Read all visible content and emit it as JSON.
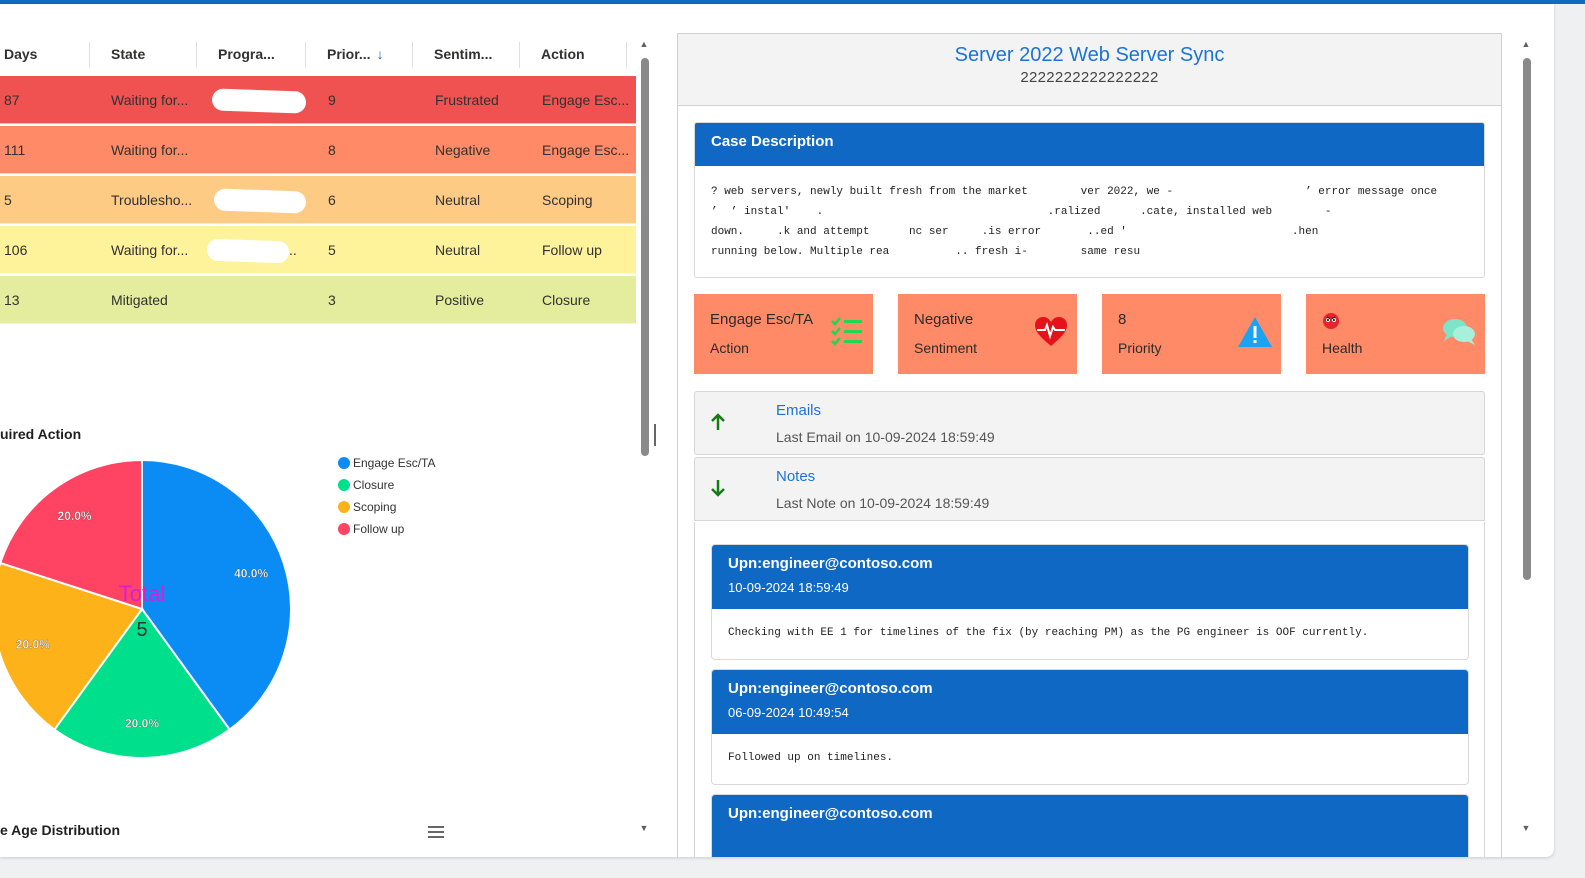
{
  "grid": {
    "headers": [
      {
        "label": "Days"
      },
      {
        "label": "State"
      },
      {
        "label": "Progra..."
      },
      {
        "label": "Prior...",
        "sort_icon": "arrow-down-icon"
      },
      {
        "label": "Sentim..."
      },
      {
        "label": "Action"
      }
    ],
    "rows": [
      {
        "days": "87",
        "state": "Waiting for...",
        "program": "",
        "priority": "9",
        "sentiment": "Frustrated",
        "action": "Engage Esc...",
        "color": "#f05252"
      },
      {
        "days": "111",
        "state": "Waiting for...",
        "program": "",
        "priority": "8",
        "sentiment": "Negative",
        "action": "Engage Esc...",
        "color": "#fe8a67"
      },
      {
        "days": "5",
        "state": "Troublesho...",
        "program": "",
        "priority": "6",
        "sentiment": "Neutral",
        "action": "Scoping",
        "color": "#fecb84"
      },
      {
        "days": "106",
        "state": "Waiting for...",
        "program": "..",
        "priority": "5",
        "sentiment": "Neutral",
        "action": "Follow up",
        "color": "#fef29a"
      },
      {
        "days": "13",
        "state": "Mitigated",
        "program": "",
        "priority": "3",
        "sentiment": "Positive",
        "action": "Closure",
        "color": "#e4ed9d"
      }
    ]
  },
  "action_chart_title": "uired Action",
  "age_chart_title": "e Age Distribution",
  "chart_data": {
    "type": "pie",
    "title": "",
    "center_label": "Total",
    "center_value": "5",
    "slices": [
      {
        "name": "Engage Esc/TA",
        "value": 40.0,
        "label": "40.0%",
        "color": "#0b8cf5"
      },
      {
        "name": "Closure",
        "value": 20.0,
        "label": "20.0%",
        "color": "#00e08c"
      },
      {
        "name": "Scoping",
        "value": 20.0,
        "label": "20.0%",
        "color": "#feb21a"
      },
      {
        "name": "Follow up",
        "value": 20.0,
        "label": "20.0%",
        "color": "#fe4462"
      }
    ],
    "legend_position": "right"
  },
  "case": {
    "title": "Server 2022 Web Server Sync",
    "id": "2222222222222222",
    "description_header": "Case Description",
    "description_lines": [
      "? web servers, newly built fresh from the market        ver 2022, we -                    ’ error message once",
      "’  ’ instal'    .                                  .ralized      .cate, installed web        -",
      "down.     .k and attempt      nc ser     .is error       ..ed '                         .hen",
      "running below. Multiple rea          .. fresh i-        same resu"
    ]
  },
  "tiles": [
    {
      "value": "Engage Esc/TA",
      "label": "Action",
      "icon": "checklist-icon"
    },
    {
      "value": "Negative",
      "label": "Sentiment",
      "icon": "heart-pulse-icon"
    },
    {
      "value": "8",
      "label": "Priority",
      "icon": "warning-icon"
    },
    {
      "value": "",
      "label": "Health",
      "icon": "angry-face-icon",
      "icon2": "chat-bubbles-icon"
    }
  ],
  "emails": {
    "title": "Emails",
    "subtitle": "Last Email on 10-09-2024 18:59:49",
    "icon": "arrow-up-icon"
  },
  "notes": {
    "title": "Notes",
    "subtitle": "Last Note on 10-09-2024 18:59:49",
    "icon": "arrow-down-icon"
  },
  "note_items": [
    {
      "upn": "Upn:engineer@contoso.com",
      "date": "10-09-2024 18:59:49",
      "body": "Checking with EE 1 for timelines of the fix (by reaching PM) as the PG engineer is OOF currently."
    },
    {
      "upn": "Upn:engineer@contoso.com",
      "date": "06-09-2024 10:49:54",
      "body": "Followed up on timelines."
    },
    {
      "upn": "Upn:engineer@contoso.com",
      "date": "",
      "body": ""
    }
  ]
}
